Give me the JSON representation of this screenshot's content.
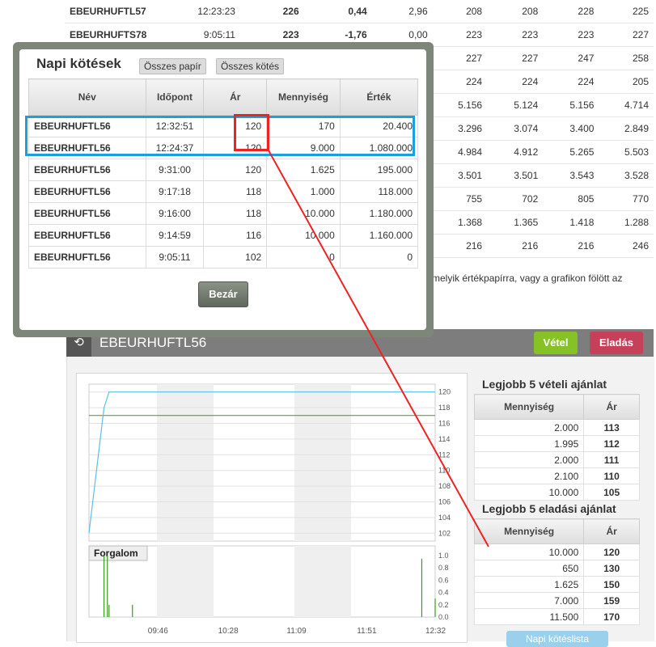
{
  "background_table": [
    {
      "name": "EBEURHUFTL57",
      "time": "12:23:23",
      "price": "226",
      "change": "0,44",
      "c5": "2,96",
      "c6": "208",
      "c7": "208",
      "c8": "228",
      "c9": "225",
      "ptype": "pos",
      "ctype": "pos"
    },
    {
      "name": "EBEURHUFTS78",
      "time": "9:05:11",
      "price": "223",
      "change": "-1,76",
      "c5": "0,00",
      "c6": "223",
      "c7": "223",
      "c8": "223",
      "c9": "227",
      "ptype": "neg",
      "ctype": "neg"
    },
    {
      "name": "",
      "time": "",
      "price": "",
      "change": "",
      "c5": "",
      "c6": "227",
      "c7": "227",
      "c8": "247",
      "c9": "258"
    },
    {
      "name": "",
      "time": "",
      "price": "",
      "change": "",
      "c5": "",
      "c6": "224",
      "c7": "224",
      "c8": "224",
      "c9": "205"
    },
    {
      "name": "",
      "time": "",
      "price": "",
      "change": "",
      "c5": "",
      "c6": "5.156",
      "c7": "5.124",
      "c8": "5.156",
      "c9": "4.714"
    },
    {
      "name": "",
      "time": "",
      "price": "",
      "change": "",
      "c5": "",
      "c6": "3.296",
      "c7": "3.074",
      "c8": "3.400",
      "c9": "2.849"
    },
    {
      "name": "",
      "time": "",
      "price": "",
      "change": "",
      "c5": "",
      "c6": "4.984",
      "c7": "4.912",
      "c8": "5.265",
      "c9": "5.503"
    },
    {
      "name": "",
      "time": "",
      "price": "",
      "change": "",
      "c5": "",
      "c6": "3.501",
      "c7": "3.501",
      "c8": "3.543",
      "c9": "3.528"
    },
    {
      "name": "",
      "time": "",
      "price": "",
      "change": "",
      "c5": "",
      "c6": "755",
      "c7": "702",
      "c8": "805",
      "c9": "770"
    },
    {
      "name": "",
      "time": "",
      "price": "",
      "change": "",
      "c5": "",
      "c6": "1.368",
      "c7": "1.365",
      "c8": "1.418",
      "c9": "1.288"
    },
    {
      "name": "",
      "time": "",
      "price": "",
      "change": "",
      "c5": "",
      "c6": "216",
      "c7": "216",
      "c8": "216",
      "c9": "246"
    }
  ],
  "background_text": "melyik értékpapírra, vagy a grafikon fölött az",
  "modal": {
    "title": "Napi kötések",
    "btn_all_papers": "Összes papír",
    "btn_all_trades": "Összes kötés",
    "columns": [
      "Név",
      "Időpont",
      "Ár",
      "Mennyiség",
      "Érték"
    ],
    "rows": [
      [
        "EBEURHUFTL56",
        "12:32:51",
        "120",
        "170",
        "20.400"
      ],
      [
        "EBEURHUFTL56",
        "12:24:37",
        "120",
        "9.000",
        "1.080.000"
      ],
      [
        "EBEURHUFTL56",
        "9:31:00",
        "120",
        "1.625",
        "195.000"
      ],
      [
        "EBEURHUFTL56",
        "9:17:18",
        "118",
        "1.000",
        "118.000"
      ],
      [
        "EBEURHUFTL56",
        "9:16:00",
        "118",
        "10.000",
        "1.180.000"
      ],
      [
        "EBEURHUFTL56",
        "9:14:59",
        "116",
        "10.000",
        "1.160.000"
      ],
      [
        "EBEURHUFTL56",
        "9:05:11",
        "102",
        "0",
        "0"
      ]
    ],
    "close_label": "Bezár"
  },
  "panel": {
    "icon": "refresh-icon",
    "title": "EBEURHUFTL56",
    "buy_label": "Vétel",
    "sell_label": "Eladás",
    "buy_color": "#86c226",
    "sell_color": "#c7405a",
    "napi_label": "Napi kötéslista"
  },
  "chart_data": {
    "type": "line",
    "price_axis_ticks": [
      "120",
      "118",
      "116",
      "114",
      "112",
      "110",
      "108",
      "106",
      "104",
      "102"
    ],
    "price_ylim": [
      101,
      121
    ],
    "x_ticks": [
      "09:46",
      "10:28",
      "11:09",
      "11:51",
      "12:32"
    ],
    "price_series": {
      "x": [
        "09:05",
        "09:14",
        "09:17",
        "12:32"
      ],
      "y": [
        102,
        118,
        120,
        120
      ]
    },
    "reference_line": 117,
    "volume_label": "Forgalom",
    "volume_ticks": [
      "1.0",
      "0.8",
      "0.6",
      "0.4",
      "0.2",
      "0.0"
    ],
    "volume_bars": [
      {
        "x": "09:14",
        "v": 1.0
      },
      {
        "x": "09:16",
        "v": 1.0
      },
      {
        "x": "09:17",
        "v": 0.2
      },
      {
        "x": "09:31",
        "v": 0.2
      },
      {
        "x": "12:24",
        "v": 0.95
      },
      {
        "x": "12:32",
        "v": 0.3
      }
    ]
  },
  "orderbook": {
    "buy_title": "Legjobb 5 vételi ajánlat",
    "sell_title": "Legjobb 5 eladási ajánlat",
    "col_qty": "Mennyiség",
    "col_price": "Ár",
    "buy": [
      [
        "2.000",
        "113"
      ],
      [
        "1.995",
        "112"
      ],
      [
        "2.000",
        "111"
      ],
      [
        "2.100",
        "110"
      ],
      [
        "10.000",
        "105"
      ]
    ],
    "sell": [
      [
        "10.000",
        "120"
      ],
      [
        "650",
        "130"
      ],
      [
        "1.625",
        "150"
      ],
      [
        "7.000",
        "159"
      ],
      [
        "11.500",
        "170"
      ]
    ]
  }
}
